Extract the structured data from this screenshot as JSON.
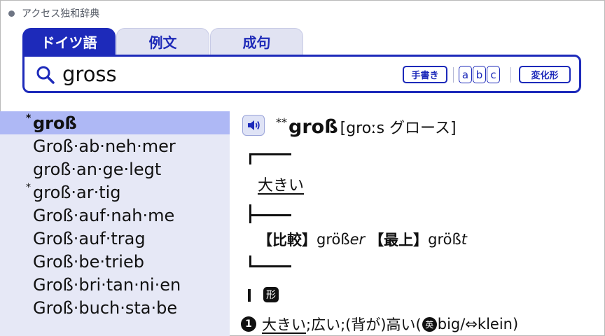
{
  "window": {
    "title": "アクセス独和辞典"
  },
  "tabs": [
    {
      "label": "ドイツ語",
      "active": true
    },
    {
      "label": "例文",
      "active": false
    },
    {
      "label": "成句",
      "active": false
    }
  ],
  "search": {
    "value": "gross",
    "handwriting_label": "手書き",
    "abc_keys": [
      "a",
      "b",
      "c"
    ],
    "conjugation_label": "変化形"
  },
  "word_list": {
    "items": [
      {
        "star": "*",
        "label": "groß",
        "selected": true
      },
      {
        "star": "",
        "label": "Groß·ab·neh·mer",
        "selected": false
      },
      {
        "star": "",
        "label": "groß·an·ge·legt",
        "selected": false
      },
      {
        "star": "*",
        "label": "groß·ar·tig",
        "selected": false
      },
      {
        "star": "",
        "label": "Groß·auf·nah·me",
        "selected": false
      },
      {
        "star": "",
        "label": "Groß·auf·trag",
        "selected": false
      },
      {
        "star": "",
        "label": "Groß·be·trieb",
        "selected": false
      },
      {
        "star": "",
        "label": "Groß·bri·tan·ni·en",
        "selected": false
      },
      {
        "star": "",
        "label": "Groß·buch·sta·be",
        "selected": false
      }
    ]
  },
  "entry": {
    "headword_star": "**",
    "headword": "groß",
    "pronunciation": "[groːs グロース]",
    "meaning_summary": "大きい",
    "forms": {
      "comparative_label": "【比較】",
      "comparative_stem": "größ",
      "comparative_ending": "er",
      "superlative_label": "【最上】",
      "superlative_stem": "größ",
      "superlative_ending": "t"
    },
    "pos_tag": "形",
    "definition": {
      "number": "1",
      "first": "大きい",
      "rest": ";広い;(背が)高い(",
      "english_badge": "英",
      "english": "big",
      "arrow": "/⇔",
      "antonym": "klein)"
    }
  },
  "colors": {
    "accent": "#1d2aba",
    "list_background": "#e6e8f6",
    "list_selected": "#aeb8f5"
  },
  "icons": {
    "search": "search-icon",
    "speaker": "speaker-icon"
  }
}
